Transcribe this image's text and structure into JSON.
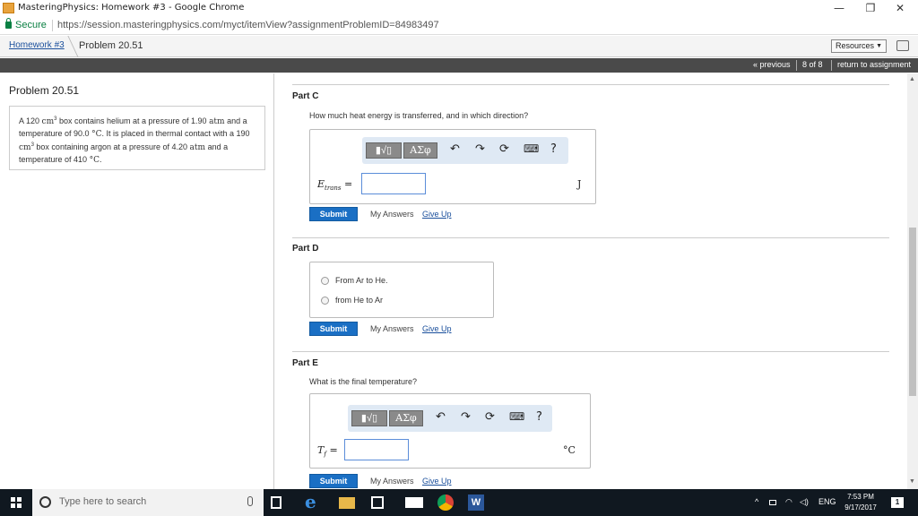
{
  "browser": {
    "window_title": "MasteringPhysics: Homework #3 - Google Chrome",
    "secure_label": "Secure",
    "url": "https://session.masteringphysics.com/myct/itemView?assignmentProblemID=84983497",
    "controls": {
      "minimize": "—",
      "restore": "❐",
      "close": "✕"
    }
  },
  "header": {
    "breadcrumb_link": "Homework #3",
    "breadcrumb_current": "Problem 20.51",
    "resources_label": "Resources",
    "resources_arrow": "▼"
  },
  "nav": {
    "previous": "« previous",
    "position": "8 of 8",
    "return": "return to assignment"
  },
  "problem": {
    "title": "Problem 20.51",
    "text_parts": [
      "A 120 ",
      "cm",
      "3",
      " box contains helium at a pressure of 1.90 ",
      "atm",
      " and a temperature of 90.0 ",
      "°C",
      ". It is placed in thermal contact with a 190 ",
      "cm",
      "3",
      " box containing argon at a pressure of 4.20 ",
      "atm",
      " and a temperature of 410 ",
      "°C",
      "."
    ]
  },
  "toolbar": {
    "templates_label": "▮√▯",
    "symbols_label": "ΑΣφ",
    "undo": "↶",
    "redo": "↷",
    "reset": "⟳",
    "keyboard": "⌨",
    "help": "?"
  },
  "parts": {
    "c": {
      "title": "Part C",
      "question": "How much heat energy is transferred, and in which direction?",
      "var_main": "E",
      "var_sub": "trans",
      "equals": "=",
      "unit": "J",
      "submit": "Submit",
      "my_answers": "My Answers",
      "give_up": "Give Up"
    },
    "d": {
      "title": "Part D",
      "options": [
        "From Ar to He.",
        "from He to Ar"
      ],
      "submit": "Submit",
      "my_answers": "My Answers",
      "give_up": "Give Up"
    },
    "e": {
      "title": "Part E",
      "question": "What is the final temperature?",
      "var_main": "T",
      "var_sub": "f",
      "equals": "=",
      "unit": "°C",
      "submit": "Submit",
      "my_answers": "My Answers",
      "give_up": "Give Up"
    }
  },
  "taskbar": {
    "search_placeholder": "Type here to search",
    "language": "ENG",
    "time": "7:53 PM",
    "date": "9/17/2017",
    "notification_count": "1"
  }
}
